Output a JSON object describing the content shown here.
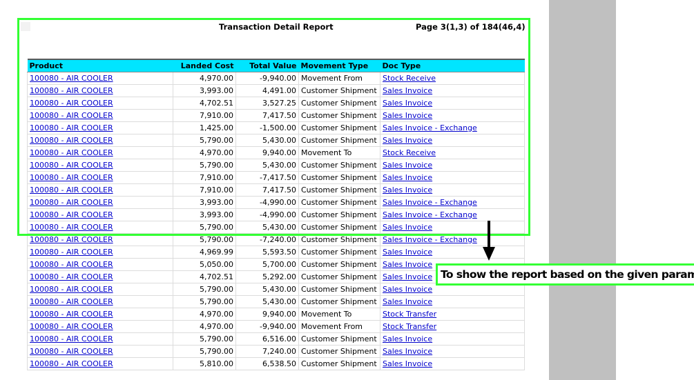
{
  "header": {
    "title": "Transaction Detail Report",
    "page_info": "Page 3(1,3) of 184(46,4)"
  },
  "table": {
    "columns": [
      "Product",
      "Landed Cost",
      "Total Value",
      "Movement Type",
      "Doc Type"
    ],
    "rows": [
      [
        "100080 - AIR COOLER",
        "4,970.00",
        "-9,940.00",
        "Movement From",
        "Stock Receive"
      ],
      [
        "100080 - AIR COOLER",
        "3,993.00",
        "4,491.00",
        "Customer Shipment",
        "Sales Invoice"
      ],
      [
        "100080 - AIR COOLER",
        "4,702.51",
        "3,527.25",
        "Customer Shipment",
        "Sales Invoice"
      ],
      [
        "100080 - AIR COOLER",
        "7,910.00",
        "7,417.50",
        "Customer Shipment",
        "Sales Invoice"
      ],
      [
        "100080 - AIR COOLER",
        "1,425.00",
        "-1,500.00",
        "Customer Shipment",
        "Sales Invoice - Exchange"
      ],
      [
        "100080 - AIR COOLER",
        "5,790.00",
        "5,430.00",
        "Customer Shipment",
        "Sales Invoice"
      ],
      [
        "100080 - AIR COOLER",
        "4,970.00",
        "9,940.00",
        "Movement To",
        "Stock Receive"
      ],
      [
        "100080 - AIR COOLER",
        "5,790.00",
        "5,430.00",
        "Customer Shipment",
        "Sales Invoice"
      ],
      [
        "100080 - AIR COOLER",
        "7,910.00",
        "-7,417.50",
        "Customer Shipment",
        "Sales Invoice"
      ],
      [
        "100080 - AIR COOLER",
        "7,910.00",
        "7,417.50",
        "Customer Shipment",
        "Sales Invoice"
      ],
      [
        "100080 - AIR COOLER",
        "3,993.00",
        "-4,990.00",
        "Customer Shipment",
        "Sales Invoice - Exchange"
      ],
      [
        "100080 - AIR COOLER",
        "3,993.00",
        "-4,990.00",
        "Customer Shipment",
        "Sales Invoice - Exchange"
      ],
      [
        "100080 - AIR COOLER",
        "5,790.00",
        "5,430.00",
        "Customer Shipment",
        "Sales Invoice"
      ],
      [
        "100080 - AIR COOLER",
        "5,790.00",
        "-7,240.00",
        "Customer Shipment",
        "Sales Invoice - Exchange"
      ],
      [
        "100080 - AIR COOLER",
        "4,969.99",
        "5,593.50",
        "Customer Shipment",
        "Sales Invoice"
      ],
      [
        "100080 - AIR COOLER",
        "5,050.00",
        "5,700.00",
        "Customer Shipment",
        "Sales Invoice"
      ],
      [
        "100080 - AIR COOLER",
        "4,702.51",
        "5,292.00",
        "Customer Shipment",
        "Sales Invoice"
      ],
      [
        "100080 - AIR COOLER",
        "5,790.00",
        "5,430.00",
        "Customer Shipment",
        "Sales Invoice"
      ],
      [
        "100080 - AIR COOLER",
        "5,790.00",
        "5,430.00",
        "Customer Shipment",
        "Sales Invoice"
      ],
      [
        "100080 - AIR COOLER",
        "4,970.00",
        "9,940.00",
        "Movement To",
        "Stock Transfer"
      ],
      [
        "100080 - AIR COOLER",
        "4,970.00",
        "-9,940.00",
        "Movement From",
        "Stock Transfer"
      ],
      [
        "100080 - AIR COOLER",
        "5,790.00",
        "6,516.00",
        "Customer Shipment",
        "Sales Invoice"
      ],
      [
        "100080 - AIR COOLER",
        "5,790.00",
        "7,240.00",
        "Customer Shipment",
        "Sales Invoice"
      ],
      [
        "100080 - AIR COOLER",
        "5,810.00",
        "6,538.50",
        "Customer Shipment",
        "Sales Invoice"
      ]
    ]
  },
  "annotation": {
    "callout_text": "To show the report based on the given parameter",
    "highlight_color": "#33ff33",
    "arrow_icon": "arrow-down-icon"
  },
  "colors": {
    "header_bg": "#00e5ff",
    "link": "#0000cc",
    "gutter": "#c0c0c0"
  }
}
